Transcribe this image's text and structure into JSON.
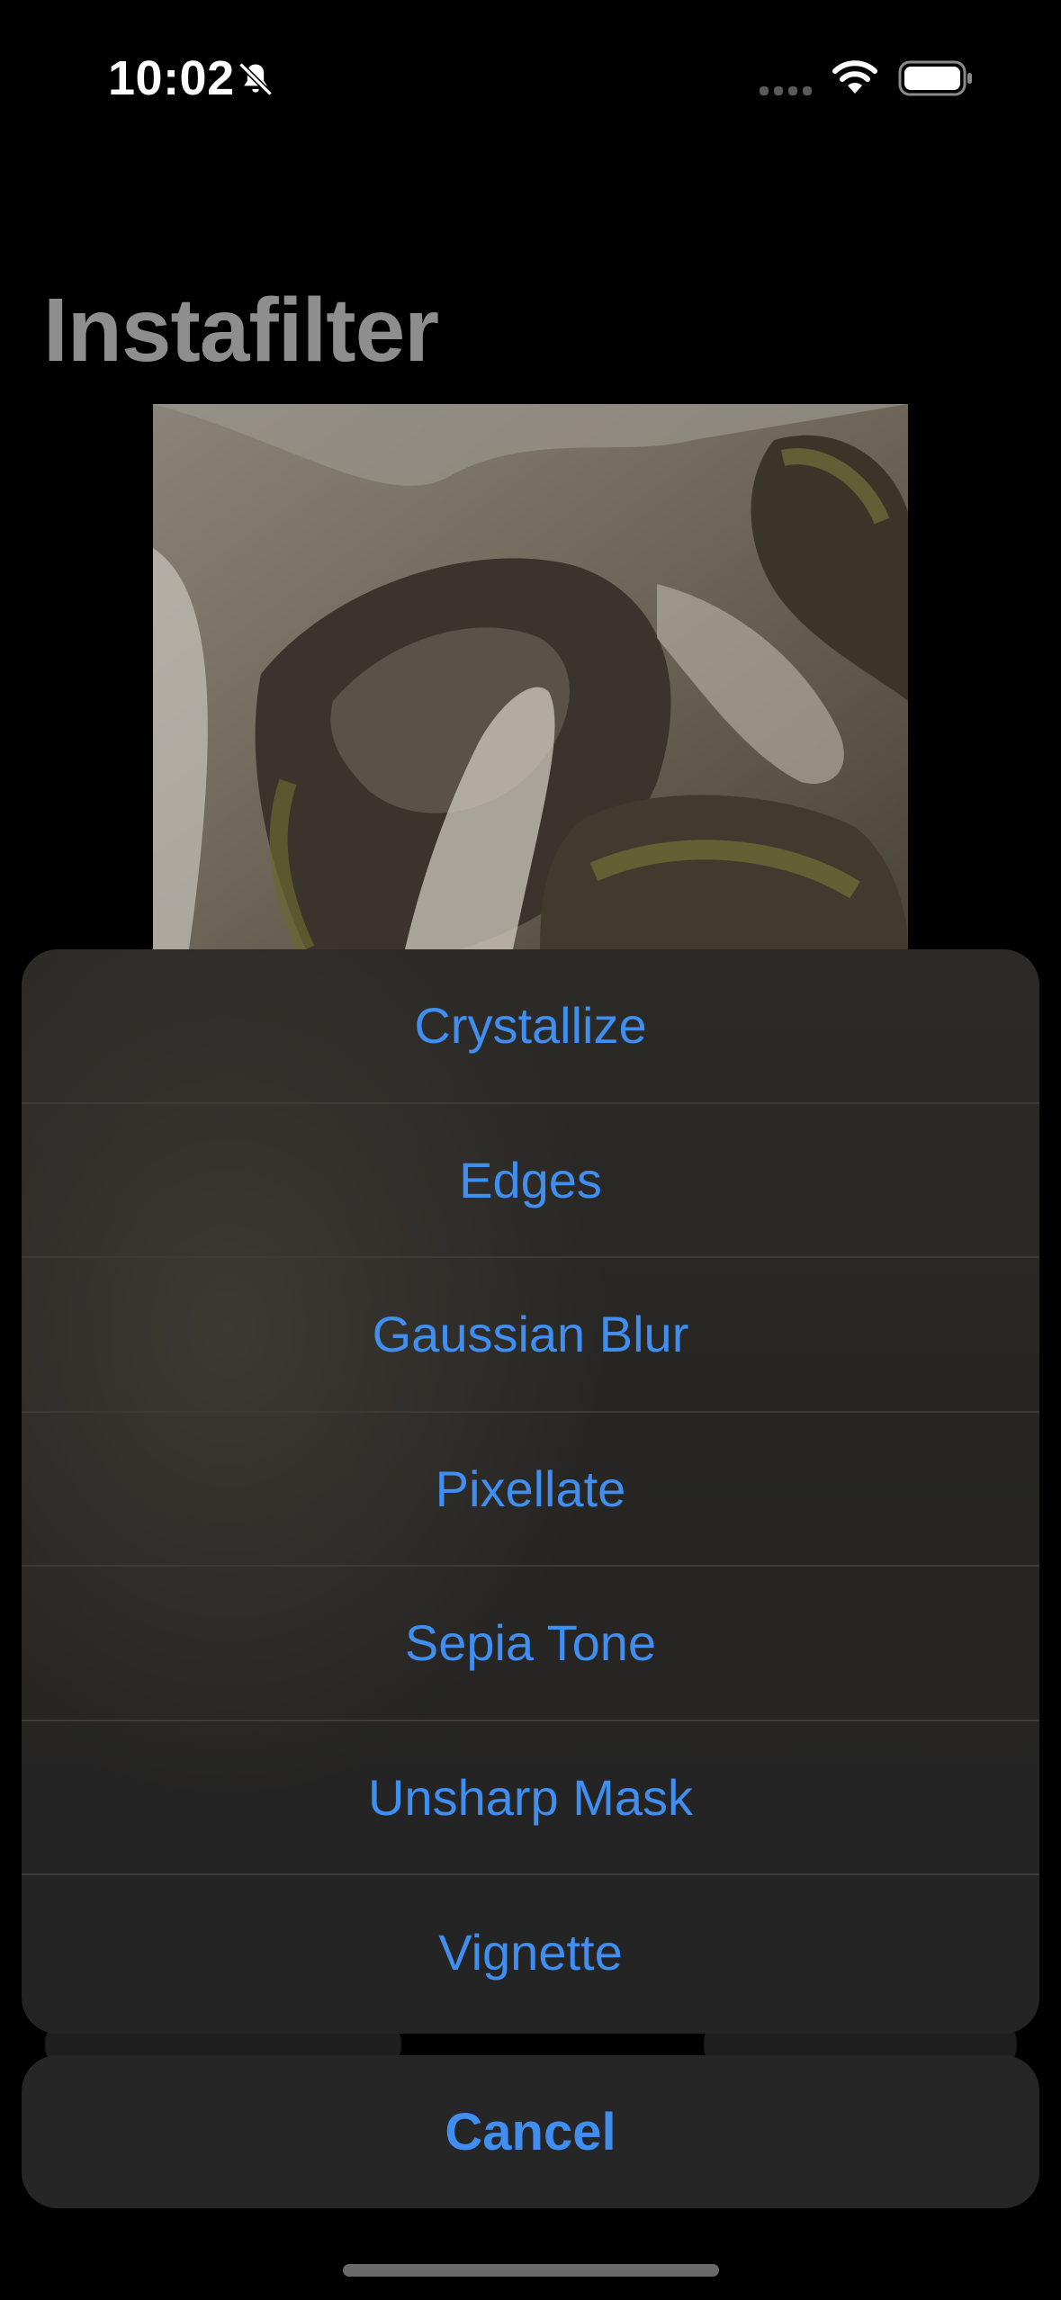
{
  "status_bar": {
    "time": "10:02",
    "icons": [
      "bell-slash-icon",
      "cellular-signal-icon",
      "wifi-icon",
      "battery-icon"
    ]
  },
  "navigation": {
    "title": "Instafilter"
  },
  "image": {
    "description_icon": "photo-image"
  },
  "action_sheet": {
    "items": [
      {
        "label": "Crystallize"
      },
      {
        "label": "Edges"
      },
      {
        "label": "Gaussian Blur"
      },
      {
        "label": "Pixellate"
      },
      {
        "label": "Sepia Tone"
      },
      {
        "label": "Unsharp Mask"
      },
      {
        "label": "Vignette"
      }
    ],
    "cancel_label": "Cancel"
  },
  "colors": {
    "accent": "#3f8ef0",
    "sheet_background": "#262523",
    "title_dimmed": "#8e8e8e"
  }
}
